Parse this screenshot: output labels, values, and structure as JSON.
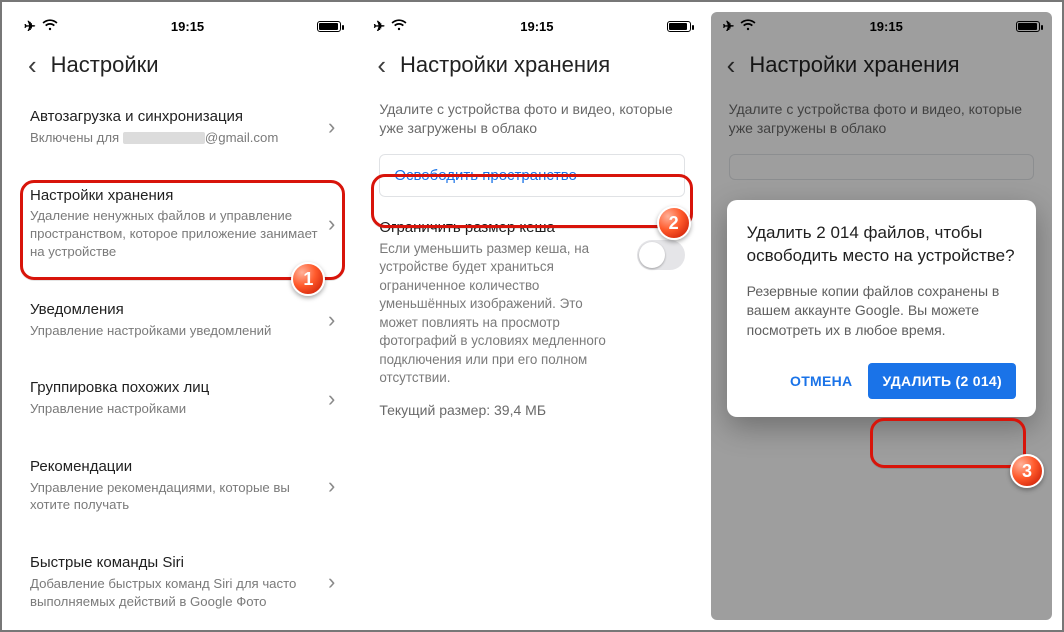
{
  "status": {
    "time": "19:15"
  },
  "p1": {
    "title": "Настройки",
    "rows": [
      {
        "title": "Автозагрузка и синхронизация",
        "sub_prefix": "Включены для",
        "sub_suffix": "@gmail.com"
      },
      {
        "title": "Настройки хранения",
        "sub": "Удаление ненужных файлов и управление пространством, которое приложение занимает на устройстве"
      },
      {
        "title": "Уведомления",
        "sub": "Управление настройками уведомлений"
      },
      {
        "title": "Группировка похожих лиц",
        "sub": "Управление настройками"
      },
      {
        "title": "Рекомендации",
        "sub": "Управление рекомендациями, которые вы хотите получать"
      },
      {
        "title": "Быстрые команды Siri",
        "sub": "Добавление быстрых команд Siri для часто выполняемых действий в Google Фото"
      }
    ]
  },
  "p2": {
    "title": "Настройки хранения",
    "desc": "Удалите с устройства фото и видео, которые уже загружены в облако",
    "freeup": "Освободить пространство",
    "cache_title": "Ограничить размер кеша",
    "cache_desc": "Если уменьшить размер кеша, на устройстве будет храниться ограниченное количество уменьшённых изображений. Это может повлиять на просмотр фотографий в условиях медленного подключения или при его полном отсутствии.",
    "cache_size": "Текущий размер: 39,4 МБ"
  },
  "p3": {
    "title": "Настройки хранения",
    "desc": "Удалите с устройства фото и видео, которые уже загружены в облако",
    "dialog_title": "Удалить 2 014 файлов, чтобы освободить место на устройстве?",
    "dialog_body": "Резервные копии файлов сохранены в вашем аккаунте Google. Вы можете посмотреть их в любое время.",
    "cancel": "ОТМЕНА",
    "delete": "УДАЛИТЬ (2 014)"
  },
  "badges": {
    "n1": "1",
    "n2": "2",
    "n3": "3"
  }
}
